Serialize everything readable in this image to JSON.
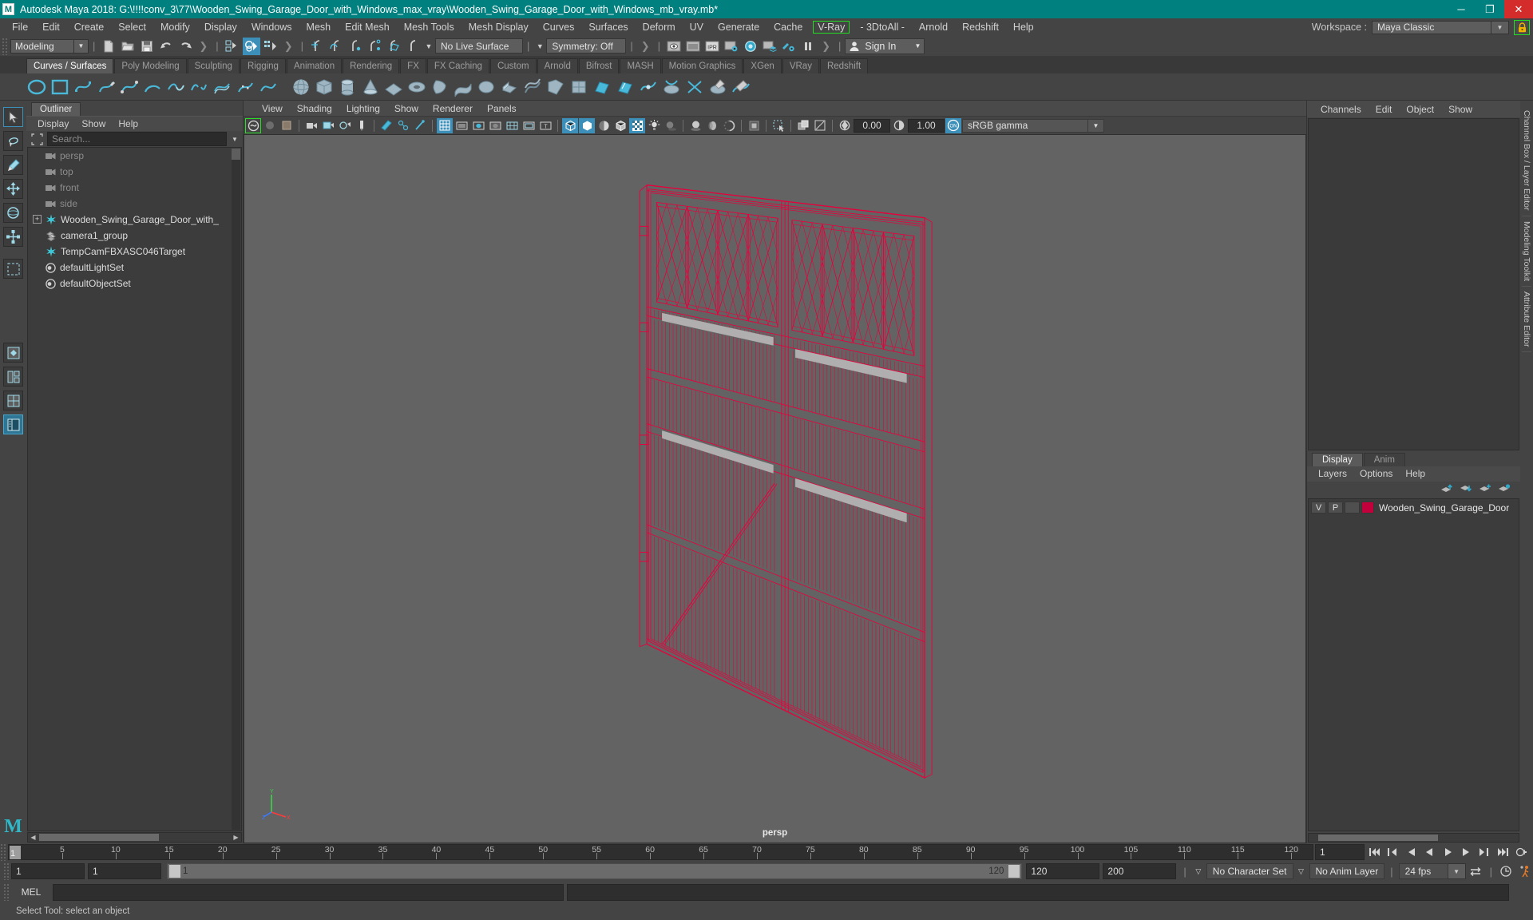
{
  "titlebar": {
    "logo": "M",
    "title": "Autodesk Maya 2018: G:\\!!!!conv_3\\77\\Wooden_Swing_Garage_Door_with_Windows_max_vray\\Wooden_Swing_Garage_Door_with_Windows_mb_vray.mb*",
    "minimize": "─",
    "maximize": "❐",
    "close": "✕"
  },
  "menubar": {
    "items": [
      {
        "label": "File",
        "boxed": false
      },
      {
        "label": "Edit",
        "boxed": false
      },
      {
        "label": "Create",
        "boxed": false
      },
      {
        "label": "Select",
        "boxed": false
      },
      {
        "label": "Modify",
        "boxed": false
      },
      {
        "label": "Display",
        "boxed": false
      },
      {
        "label": "Windows",
        "boxed": false
      },
      {
        "label": "Mesh",
        "boxed": false
      },
      {
        "label": "Edit Mesh",
        "boxed": false
      },
      {
        "label": "Mesh Tools",
        "boxed": false
      },
      {
        "label": "Mesh Display",
        "boxed": false
      },
      {
        "label": "Curves",
        "boxed": false
      },
      {
        "label": "Surfaces",
        "boxed": false
      },
      {
        "label": "Deform",
        "boxed": false
      },
      {
        "label": "UV",
        "boxed": false
      },
      {
        "label": "Generate",
        "boxed": false
      },
      {
        "label": "Cache",
        "boxed": false
      },
      {
        "label": "V-Ray",
        "boxed": true
      },
      {
        "label": "- 3DtoAll -",
        "boxed": false
      },
      {
        "label": "Arnold",
        "boxed": false
      },
      {
        "label": "Redshift",
        "boxed": false
      },
      {
        "label": "Help",
        "boxed": false
      }
    ],
    "workspace_label": "Workspace :",
    "workspace_value": "Maya Classic",
    "lock_icon": "lock-icon"
  },
  "statusline": {
    "mode": "Modeling",
    "live_surface": "No Live Surface",
    "symmetry": "Symmetry: Off",
    "signin": "Sign In",
    "icons": [
      "new-scene-icon",
      "open-scene-icon",
      "save-scene-icon",
      "undo-icon",
      "redo-icon",
      "select-by-hierarchy-icon",
      "select-by-object-icon",
      "select-by-component-icon",
      "snap-grid-icon",
      "snap-curve-icon",
      "snap-point-icon",
      "snap-projected-center-icon",
      "snap-view-plane-icon",
      "make-live-icon",
      "render-view-icon",
      "render-frame-icon",
      "ipr-icon",
      "render-settings-icon",
      "hypershade-icon",
      "render-layers-icon",
      "rendering-flags-icon",
      "pause-render-icon"
    ]
  },
  "shelf": {
    "tabs": [
      "Curves / Surfaces",
      "Poly Modeling",
      "Sculpting",
      "Rigging",
      "Animation",
      "Rendering",
      "FX",
      "FX Caching",
      "Custom",
      "Arnold",
      "Bifrost",
      "MASH",
      "Motion Graphics",
      "XGen",
      "VRay",
      "Redshift"
    ],
    "active_tab": "Curves / Surfaces"
  },
  "toolbox": {
    "tools": [
      "select-tool",
      "lasso-select-tool",
      "paint-select-tool",
      "move-tool",
      "rotate-tool",
      "scale-tool",
      "last-tool",
      "show-manipulator-tool",
      "outliner-layout",
      "persp-outliner-layout",
      "four-view-layout",
      "persp-graph-layout"
    ]
  },
  "outliner": {
    "tab": "Outliner",
    "menus": [
      "Display",
      "Show",
      "Help"
    ],
    "search_placeholder": "Search...",
    "items": [
      {
        "label": "persp",
        "icon": "camera-icon",
        "dim": true,
        "expand": false
      },
      {
        "label": "top",
        "icon": "camera-icon",
        "dim": true,
        "expand": false
      },
      {
        "label": "front",
        "icon": "camera-icon",
        "dim": true,
        "expand": false
      },
      {
        "label": "side",
        "icon": "camera-icon",
        "dim": true,
        "expand": false
      },
      {
        "label": "Wooden_Swing_Garage_Door_with_",
        "icon": "transform-icon",
        "dim": false,
        "expand": true
      },
      {
        "label": "camera1_group",
        "icon": "group-icon",
        "dim": false,
        "expand": false
      },
      {
        "label": "TempCamFBXASC046Target",
        "icon": "transform-icon",
        "dim": false,
        "expand": false
      },
      {
        "label": "defaultLightSet",
        "icon": "set-icon",
        "dim": false,
        "expand": false
      },
      {
        "label": "defaultObjectSet",
        "icon": "set-icon",
        "dim": false,
        "expand": false
      }
    ]
  },
  "viewport": {
    "menus": [
      "View",
      "Shading",
      "Lighting",
      "Show",
      "Renderer",
      "Panels"
    ],
    "exposure": "0.00",
    "gamma": "1.00",
    "color_management": "sRGB gamma",
    "camera_label": "persp",
    "wireframe_color": "#e8003c",
    "background_color": "#636363",
    "axis": {
      "x": "X",
      "y": "Y",
      "z": "Z"
    }
  },
  "channelbox": {
    "menus": [
      "Channels",
      "Edit",
      "Object",
      "Show"
    ]
  },
  "layers": {
    "tabs": [
      "Display",
      "Anim"
    ],
    "active_tab": "Display",
    "menus": [
      "Layers",
      "Options",
      "Help"
    ],
    "columns": [
      "V",
      "P"
    ],
    "rows": [
      {
        "v": "V",
        "p": "P",
        "color": "#c2003c",
        "name": "Wooden_Swing_Garage_Door"
      }
    ]
  },
  "vtabs": [
    "Channel Box / Layer Editor",
    "Modeling Toolkit",
    "Attribute Editor"
  ],
  "timeline": {
    "current_frame": "1",
    "ticks": [
      {
        "value": "5",
        "frame": 5
      },
      {
        "value": "10",
        "frame": 10
      },
      {
        "value": "15",
        "frame": 15
      },
      {
        "value": "20",
        "frame": 20
      },
      {
        "value": "25",
        "frame": 25
      },
      {
        "value": "30",
        "frame": 30
      },
      {
        "value": "35",
        "frame": 35
      },
      {
        "value": "40",
        "frame": 40
      },
      {
        "value": "45",
        "frame": 45
      },
      {
        "value": "50",
        "frame": 50
      },
      {
        "value": "55",
        "frame": 55
      },
      {
        "value": "60",
        "frame": 60
      },
      {
        "value": "65",
        "frame": 65
      },
      {
        "value": "70",
        "frame": 70
      },
      {
        "value": "75",
        "frame": 75
      },
      {
        "value": "80",
        "frame": 80
      },
      {
        "value": "85",
        "frame": 85
      },
      {
        "value": "90",
        "frame": 90
      },
      {
        "value": "95",
        "frame": 95
      },
      {
        "value": "100",
        "frame": 100
      },
      {
        "value": "105",
        "frame": 105
      },
      {
        "value": "110",
        "frame": 110
      },
      {
        "value": "115",
        "frame": 115
      },
      {
        "value": "120",
        "frame": 120
      }
    ],
    "field_frame": "1",
    "anim_start": "1",
    "anim_start2": "1",
    "range_start": "1",
    "range_end": "120",
    "playback_end": "120",
    "anim_end": "200",
    "character_set": "No Character Set",
    "anim_layer": "No Anim Layer",
    "fps": "24 fps",
    "auto_key_icon": "auto-key-icon",
    "anim_prefs_icon": "animation-preferences-icon"
  },
  "commandline": {
    "mel_label": "MEL",
    "mel_value": "",
    "status_text": "Select Tool: select an object"
  }
}
